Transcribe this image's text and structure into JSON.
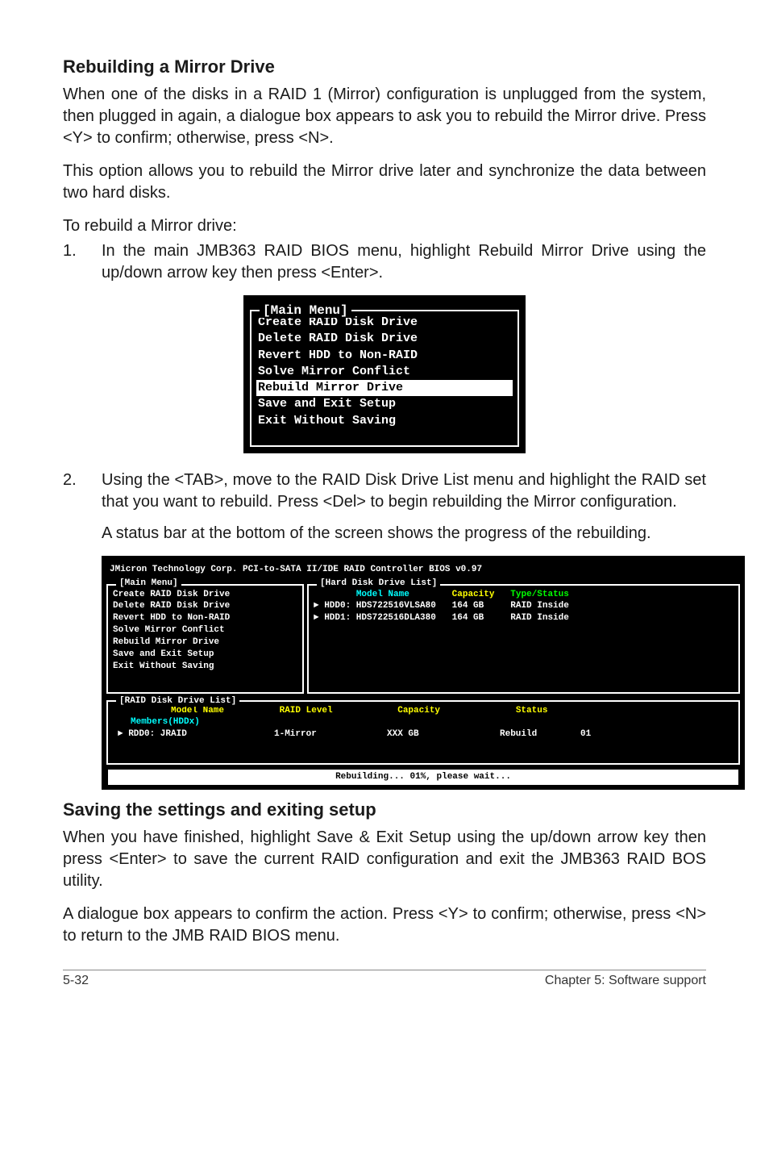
{
  "section1": {
    "title": "Rebuilding a Mirror Drive",
    "p1": "When one of the disks in a RAID 1 (Mirror) configuration is unplugged from the system, then plugged in again, a dialogue box appears to ask you to rebuild the Mirror drive. Press <Y> to confirm; otherwise, press <N>.",
    "p2": "This option allows you to rebuild the Mirror drive later and synchronize the data between two hard disks.",
    "p3": "To rebuild a Mirror drive:",
    "step1_num": "1.",
    "step1_txt": "In the main JMB363 RAID BIOS menu, highlight Rebuild Mirror Drive using the up/down arrow key then press <Enter>.",
    "step2_num": "2.",
    "step2_txt": "Using the <TAB>, move to the RAID Disk Drive List menu and highlight the RAID set that you want to rebuild. Press <Del> to begin rebuilding the Mirror configuration.",
    "step2_sub": "A status bar at the bottom of the screen shows the progress of the rebuilding."
  },
  "menu1": {
    "legend": "[Main Menu]",
    "items": [
      "Create RAID Disk Drive",
      "Delete RAID Disk Drive",
      "Revert HDD to Non-RAID",
      "Solve Mirror Conflict",
      "Rebuild Mirror Drive",
      "Save and Exit Setup",
      "Exit Without Saving"
    ],
    "selected_index": 4
  },
  "bios": {
    "title": "JMicron Technology Corp. PCI-to-SATA II/IDE RAID Controller BIOS v0.97",
    "main_legend": "[Main Menu]",
    "main_items": [
      "Create RAID Disk Drive",
      "Delete RAID Disk Drive",
      "Revert HDD to Non-RAID",
      "Solve Mirror Conflict",
      "Rebuild Mirror Drive",
      "Save and Exit Setup",
      "Exit Without Saving"
    ],
    "hd_legend": "[Hard Disk Drive List]",
    "hd_header": {
      "model": "Model Name",
      "cap": "Capacity",
      "type": "Type/Status"
    },
    "hd_rows": [
      {
        "dev": "HDD0:",
        "model": "HDS722516VLSA80",
        "cap": "164 GB",
        "type": "RAID Inside"
      },
      {
        "dev": "HDD1:",
        "model": "HDS722516DLA380",
        "cap": "164 GB",
        "type": "RAID Inside"
      }
    ],
    "rd_legend": "[RAID Disk Drive List]",
    "rd_header": {
      "model": "Model Name",
      "level": "RAID Level",
      "cap": "Capacity",
      "status": "Status"
    },
    "rd_members": "Members(HDDx)",
    "rd_rows": [
      {
        "dev": "RDD0:",
        "name": "JRAID",
        "level": "1-Mirror",
        "cap": "XXX GB",
        "status": "Rebuild",
        "extra": "01"
      }
    ],
    "status": "Rebuilding... 01%, please wait..."
  },
  "section2": {
    "title": "Saving the settings and exiting setup",
    "p1": "When you have finished, highlight Save & Exit Setup using the up/down arrow key then press <Enter> to save the current RAID configuration and exit the JMB363 RAID BOS utility.",
    "p2": "A dialogue box appears to confirm the action. Press <Y> to confirm; otherwise, press <N> to return to the JMB RAID BIOS menu."
  },
  "footer": {
    "left": "5-32",
    "right": "Chapter 5: Software support"
  }
}
